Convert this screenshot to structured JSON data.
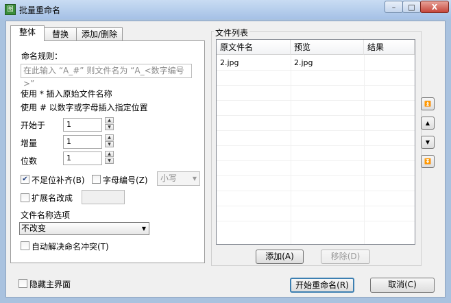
{
  "window": {
    "title": "批量重命名",
    "app_icon": "图",
    "min_glyph": "–",
    "max_glyph": "□",
    "close_glyph": "X"
  },
  "tabs": [
    "整体",
    "替换",
    "添加/删除"
  ],
  "left": {
    "rule_label": "命名规则：",
    "rule_placeholder": "在此输入 “A_#” 则文件名为 “A_<数字编号>”",
    "hint1": "使用 * 插入原始文件名称",
    "hint2": "使用 # 以数字或字母插入指定位置",
    "start_label": "开始于",
    "start_value": "1",
    "step_label": "增量",
    "step_value": "1",
    "digits_label": "位数",
    "digits_value": "1",
    "pad_label": "不足位补齐(B)",
    "pad_checked": true,
    "letter_label": "字母编号(Z)",
    "letter_checked": false,
    "case_value": "小写",
    "ext_label": "扩展名改成",
    "ext_checked": false,
    "name_opt_label": "文件名称选项",
    "name_opt_value": "不改变",
    "auto_label": "自动解决命名冲突(T)",
    "auto_checked": false,
    "check_glyph": "✔",
    "spin_up": "▲",
    "spin_down": "▼",
    "dropdown_glyph": "▼"
  },
  "right": {
    "group_title": "文件列表",
    "columns": [
      "原文件名",
      "预览",
      "结果"
    ],
    "rows": [
      {
        "original": "2.jpg",
        "preview": "2.jpg",
        "result": ""
      }
    ],
    "add_label": "添加(A)",
    "remove_label": "移除(D)",
    "move_glyphs": [
      "⏫",
      "▲",
      "▼",
      "⏬"
    ]
  },
  "footer": {
    "hide_label": "隐藏主界面",
    "hide_checked": false,
    "start_label": "开始重命名(R)",
    "cancel_label": "取消(C)"
  }
}
